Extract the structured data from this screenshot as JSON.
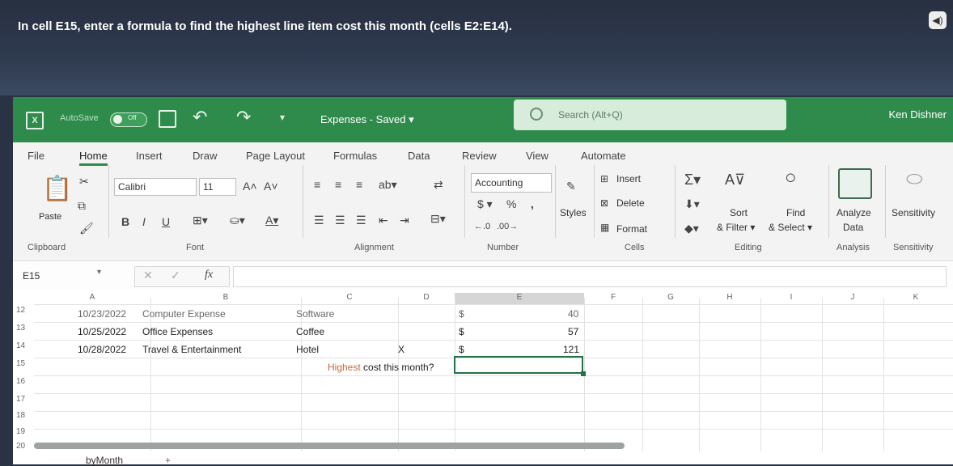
{
  "instruction": "In cell E15, enter a formula to find the highest line item cost this month (cells E2:E14).",
  "titlebar": {
    "autosave_label": "AutoSave",
    "toggle_state": "Off",
    "doc_title": "Expenses - Saved ▾",
    "search_placeholder": "Search (Alt+Q)",
    "user_name": "Ken Dishner"
  },
  "ribbon": {
    "tabs": [
      "File",
      "Home",
      "Insert",
      "Draw",
      "Page Layout",
      "Formulas",
      "Data",
      "Review",
      "View",
      "Automate"
    ],
    "font_name": "Calibri",
    "font_size": "11",
    "number_format": "Accounting",
    "paste_label": "Paste",
    "styles_label": "Styles",
    "insert_label": "Insert",
    "delete_label": "Delete",
    "format_label": "Format",
    "sort_label": "Sort",
    "filter_label": "& Filter ▾",
    "find_label": "Find",
    "select_label": "& Select ▾",
    "analyze_label": "Analyze",
    "analyze_label2": "Data",
    "sensitivity_label": "Sensitivity",
    "groups": [
      "Clipboard",
      "Font",
      "Alignment",
      "Number",
      "Cells",
      "Editing",
      "Analysis",
      "Sensitivity"
    ]
  },
  "formula_bar": {
    "name_box": "E15",
    "fx": "fx"
  },
  "grid": {
    "columns": [
      "A",
      "B",
      "C",
      "D",
      "E",
      "F",
      "G",
      "H",
      "I",
      "J",
      "K"
    ],
    "rows": [
      {
        "num": "12",
        "a": "10/23/2022",
        "b": "Computer Expense",
        "c": "Software",
        "d": "",
        "e_symbol": "$",
        "e_value": "40"
      },
      {
        "num": "13",
        "a": "10/25/2022",
        "b": "Office Expenses",
        "c": "Coffee",
        "d": "",
        "e_symbol": "$",
        "e_value": "57"
      },
      {
        "num": "14",
        "a": "10/28/2022",
        "b": "Travel & Entertainment",
        "c": "Hotel",
        "d": "X",
        "e_symbol": "$",
        "e_value": "121"
      },
      {
        "num": "15",
        "label_prefix": "Highest",
        "label_rest": " cost this month?"
      },
      {
        "num": "16"
      },
      {
        "num": "17"
      },
      {
        "num": "18"
      },
      {
        "num": "19"
      },
      {
        "num": "20"
      }
    ],
    "sheet_tab": "byMonth"
  }
}
